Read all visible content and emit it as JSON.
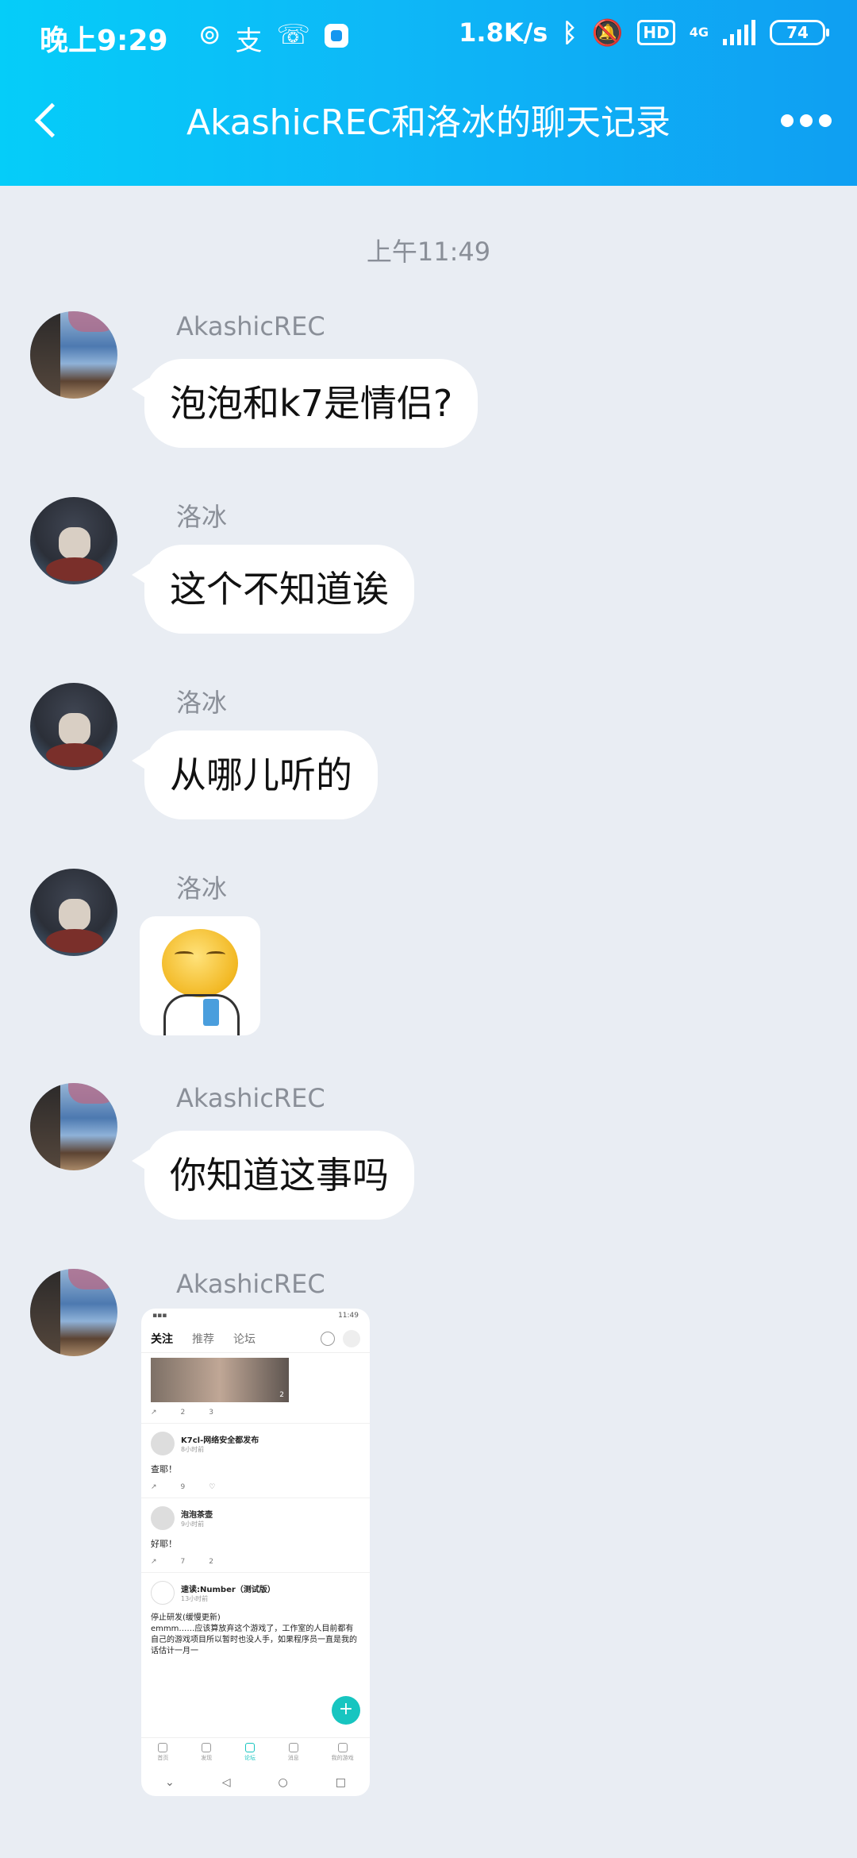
{
  "status_bar": {
    "time": "晚上9:29",
    "speed": "1.8K/s",
    "hd": "HD",
    "net": "4G",
    "battery": "74"
  },
  "nav": {
    "title": "AkashicREC和洛冰的聊天记录"
  },
  "chat": {
    "timestamp": "上午11:49",
    "messages": [
      {
        "sender": "AkashicREC",
        "text": "泡泡和k7是情侣?"
      },
      {
        "sender": "洛冰",
        "text": "这个不知道诶"
      },
      {
        "sender": "洛冰",
        "text": "从哪儿听的"
      },
      {
        "sender": "洛冰",
        "sticker": "smiling-face-sticker"
      },
      {
        "sender": "AkashicREC",
        "text": "你知道这事吗"
      },
      {
        "sender": "AkashicREC",
        "image": "forum-screenshot"
      }
    ]
  },
  "screenshot": {
    "status_time": "11:49",
    "tabs": [
      "关注",
      "推荐",
      "论坛"
    ],
    "image_count": "2",
    "first_actions": {
      "comments": "2",
      "likes": "3"
    },
    "posts": [
      {
        "name": "K7cl-网络安全都发布",
        "time": "8小时前",
        "body": "查耶！",
        "comments": "9",
        "likes": ""
      },
      {
        "name": "泡泡茶壶",
        "time": "9小时前",
        "body": "好耶！",
        "comments": "7",
        "likes": "2"
      },
      {
        "name": "速读:Number（测试版）",
        "time": "13小时前",
        "body": "停止研发(缓慢更新)\nemmm……应该算放弃这个游戏了，工作室的人目前都有自己的游戏项目所以暂时也没人手，如果程序员一直是我的话估计一月一",
        "comments": "",
        "likes": ""
      }
    ],
    "bottom_tabs": [
      "首页",
      "发现",
      "论坛",
      "消息",
      "我的游戏"
    ],
    "fab": "+"
  }
}
